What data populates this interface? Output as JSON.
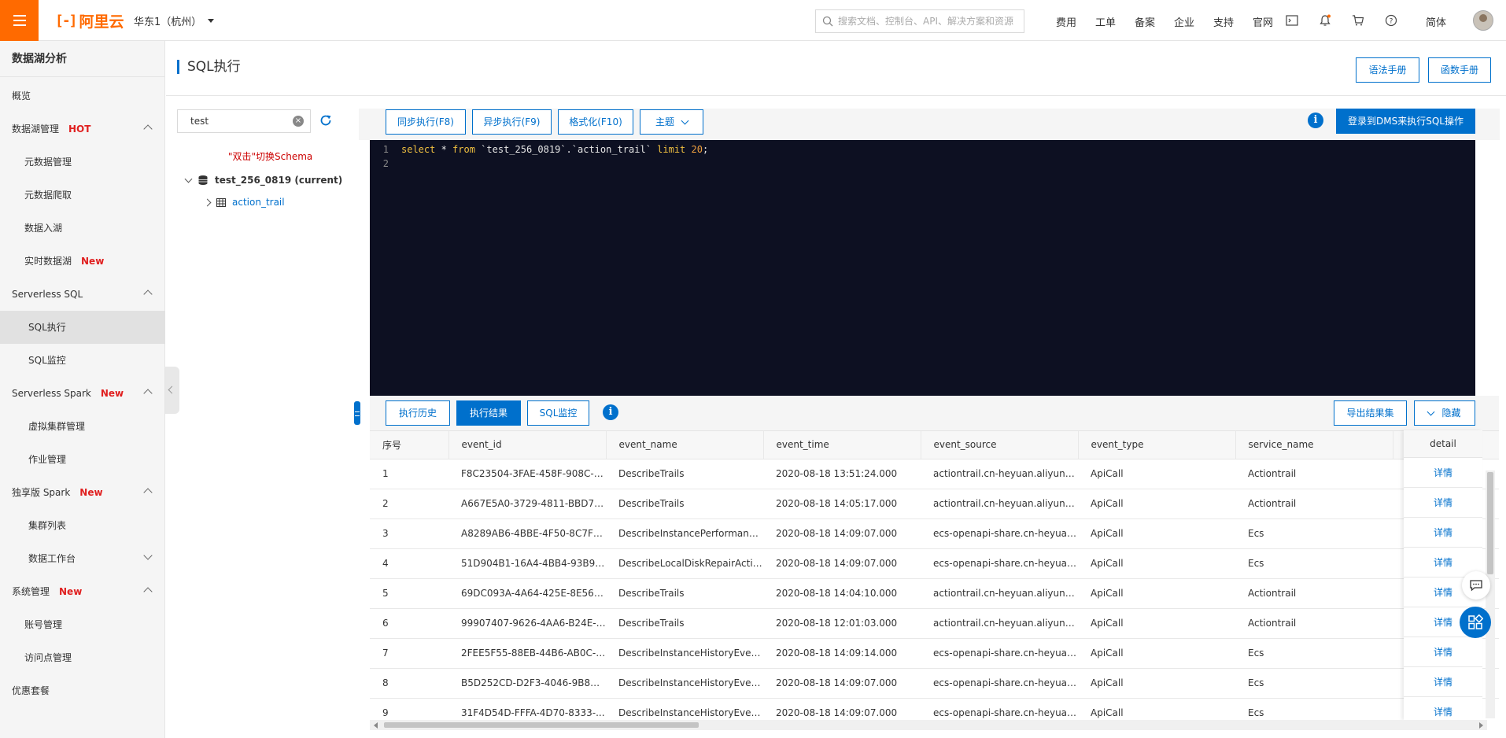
{
  "topbar": {
    "logo_text": "阿里云",
    "region": "华东1（杭州）",
    "search_placeholder": "搜索文档、控制台、API、解决方案和资源",
    "nav": [
      "费用",
      "工单",
      "备案",
      "企业",
      "支持",
      "官网"
    ],
    "language": "简体"
  },
  "sidebar": {
    "title": "数据湖分析",
    "items": [
      {
        "label": "概览"
      },
      {
        "label": "数据湖管理",
        "badge": "HOT"
      },
      {
        "label": "元数据管理"
      },
      {
        "label": "元数据爬取"
      },
      {
        "label": "数据入湖"
      },
      {
        "label": "实时数据湖",
        "badge": "New"
      },
      {
        "label": "Serverless SQL"
      },
      {
        "label": "SQL执行"
      },
      {
        "label": "SQL监控"
      },
      {
        "label": "Serverless Spark",
        "badge": "New"
      },
      {
        "label": "虚拟集群管理"
      },
      {
        "label": "作业管理"
      },
      {
        "label": "独享版 Spark",
        "badge": "New"
      },
      {
        "label": "集群列表"
      },
      {
        "label": "数据工作台"
      },
      {
        "label": "系统管理",
        "badge": "New"
      },
      {
        "label": "账号管理"
      },
      {
        "label": "访问点管理"
      },
      {
        "label": "优惠套餐"
      }
    ]
  },
  "page": {
    "title": "SQL执行",
    "syntax_manual": "语法手册",
    "function_manual": "函数手册"
  },
  "schema": {
    "search_value": "test",
    "hint": "\"双击\"切换Schema",
    "database": "test_256_0819 (current)",
    "table": "action_trail"
  },
  "editor": {
    "sync_exec": "同步执行(F8)",
    "async_exec": "异步执行(F9)",
    "format": "格式化(F10)",
    "theme": "主题",
    "dms_button": "登录到DMS来执行SQL操作",
    "line1_no": "1",
    "line2_no": "2",
    "line1_kw1": "select",
    "line1_mid": " * ",
    "line1_kw2": "from",
    "line1_obj": " `test_256_0819`.`action_trail` ",
    "line1_kw3": "limit",
    "line1_num": " 20",
    "line1_end": ";"
  },
  "results": {
    "history_tab": "执行历史",
    "result_tab": "执行结果",
    "monitor_tab": "SQL监控",
    "export": "导出结果集",
    "hide": "隐藏",
    "columns": [
      "序号",
      "event_id",
      "event_name",
      "event_time",
      "event_source",
      "event_type",
      "service_name"
    ],
    "detail_header": "detail",
    "detail_link": "详情",
    "rows": [
      [
        "1",
        "F8C23504-3FAE-458F-908C-C...",
        "DescribeTrails",
        "2020-08-18 13:51:24.000",
        "actiontrail.cn-heyuan.aliyuncs....",
        "ApiCall",
        "Actiontrail"
      ],
      [
        "2",
        "A667E5A0-3729-4811-BBD7-...",
        "DescribeTrails",
        "2020-08-18 14:05:17.000",
        "actiontrail.cn-heyuan.aliyuncs....",
        "ApiCall",
        "Actiontrail"
      ],
      [
        "3",
        "A8289AB6-4BBE-4F50-8C7F-8...",
        "DescribeInstancePerformance...",
        "2020-08-18 14:09:07.000",
        "ecs-openapi-share.cn-heyuan....",
        "ApiCall",
        "Ecs"
      ],
      [
        "4",
        "51D904B1-16A4-4BB4-93B9-...",
        "DescribeLocalDiskRepairActivi...",
        "2020-08-18 14:09:07.000",
        "ecs-openapi-share.cn-heyuan....",
        "ApiCall",
        "Ecs"
      ],
      [
        "5",
        "69DC093A-4A64-425E-8E56-...",
        "DescribeTrails",
        "2020-08-18 14:04:10.000",
        "actiontrail.cn-heyuan.aliyuncs....",
        "ApiCall",
        "Actiontrail"
      ],
      [
        "6",
        "99907407-9626-4AA6-B24E-8...",
        "DescribeTrails",
        "2020-08-18 12:01:03.000",
        "actiontrail.cn-heyuan.aliyuncs....",
        "ApiCall",
        "Actiontrail"
      ],
      [
        "7",
        "2FEE5F55-88EB-44B6-AB0C-0...",
        "DescribeInstanceHistoryEvents",
        "2020-08-18 14:09:14.000",
        "ecs-openapi-share.cn-heyuan....",
        "ApiCall",
        "Ecs"
      ],
      [
        "8",
        "B5D252CD-D2F3-4046-9B8B-...",
        "DescribeInstanceHistoryEvents",
        "2020-08-18 14:09:07.000",
        "ecs-openapi-share.cn-heyuan....",
        "ApiCall",
        "Ecs"
      ],
      [
        "9",
        "31F4D54D-FFFA-4D70-8333-...",
        "DescribeInstanceHistoryEvents",
        "2020-08-18 14:09:07.000",
        "ecs-openapi-share.cn-heyuan....",
        "ApiCall",
        "Ecs"
      ]
    ]
  },
  "colors": {
    "brand": "#ff6a00",
    "primary": "#0070cc",
    "editor_bg": "#0d1022",
    "badge": "#e02020"
  }
}
